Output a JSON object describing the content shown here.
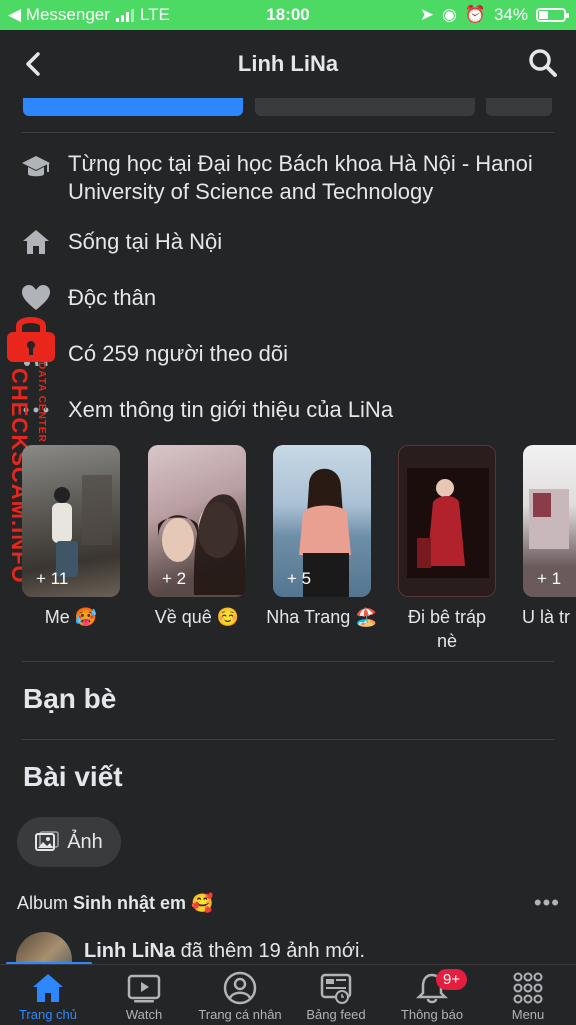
{
  "status_bar": {
    "back_app": "◀ Messenger",
    "network": "LTE",
    "time": "18:00",
    "battery": "34%",
    "battery_level": 0.34,
    "accent": "#4cd964"
  },
  "header": {
    "title": "Linh LiNa"
  },
  "intro": [
    {
      "icon": "graduation-cap-icon",
      "text": "Từng học tại Đại học Bách khoa Hà Nội - Hanoi University of Science and Technology"
    },
    {
      "icon": "home-icon",
      "text": "Sống tại Hà Nội"
    },
    {
      "icon": "heart-icon",
      "text": "Độc thân"
    },
    {
      "icon": "rss-icon",
      "text": "Có 259 người theo dõi"
    },
    {
      "icon": "more-dots-icon",
      "text": "Xem thông tin giới thiệu của LiNa"
    }
  ],
  "watermark": {
    "main": "CHECKSCAM.INFO",
    "sub": "DATA CENTER"
  },
  "featured": [
    {
      "label": "Me 🥵",
      "count": "+ 11"
    },
    {
      "label": "Về quê ☺️",
      "count": "+ 2"
    },
    {
      "label": "Nha Trang 🏖️",
      "count": "+ 5"
    },
    {
      "label": "Đi bê tráp nè",
      "count": ""
    },
    {
      "label": "U là tr",
      "count": "+ 1"
    }
  ],
  "sections": {
    "friends": "Bạn bè",
    "posts": "Bài viết"
  },
  "photo_button": "Ảnh",
  "album": {
    "prefix": "Album",
    "name": "Sinh nhật em 🥰",
    "more": "•••"
  },
  "post": {
    "author": "Linh LiNa",
    "action": "đã thêm 19 ảnh mới."
  },
  "tabbar": {
    "items": [
      {
        "label": "Trang chủ",
        "icon": "home-icon"
      },
      {
        "label": "Watch",
        "icon": "watch-play-icon"
      },
      {
        "label": "Trang cá nhân",
        "icon": "profile-icon"
      },
      {
        "label": "Bảng feed",
        "icon": "feed-icon"
      },
      {
        "label": "Thông báo",
        "icon": "bell-icon"
      },
      {
        "label": "Menu",
        "icon": "menu-grid-icon"
      }
    ],
    "notification_badge": "9+",
    "accent": "#2d88ff"
  }
}
